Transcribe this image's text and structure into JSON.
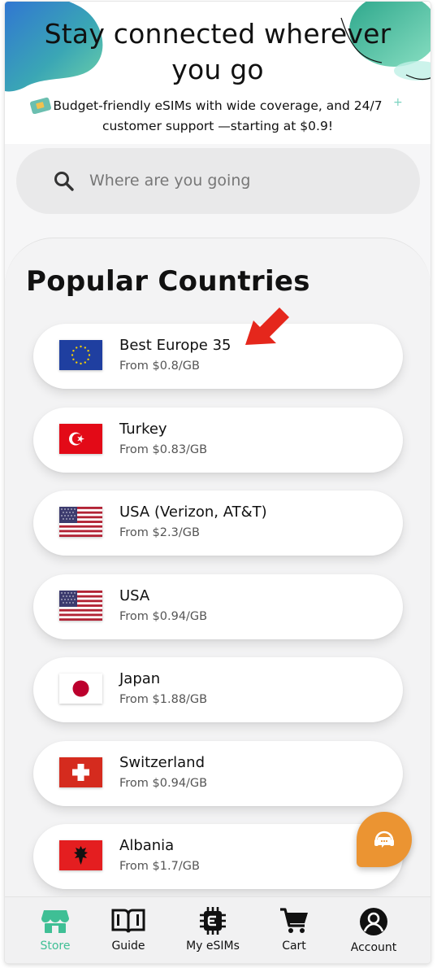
{
  "hero": {
    "title": "Stay connected wherever you go",
    "subtitle": "Budget-friendly eSIMs with wide coverage, and 24/7 customer support —starting at $0.9!"
  },
  "search": {
    "placeholder": "Where are you going"
  },
  "popular": {
    "title": "Popular Countries",
    "items": [
      {
        "name": "Best Europe 35",
        "price": "From $0.8/GB",
        "flag": "eu-flag"
      },
      {
        "name": "Turkey",
        "price": "From $0.83/GB",
        "flag": "turkey-flag"
      },
      {
        "name": "USA (Verizon, AT&T)",
        "price": "From $2.3/GB",
        "flag": "usa-flag"
      },
      {
        "name": "USA",
        "price": "From $0.94/GB",
        "flag": "usa-flag"
      },
      {
        "name": "Japan",
        "price": "From $1.88/GB",
        "flag": "japan-flag"
      },
      {
        "name": "Switzerland",
        "price": "From $0.94/GB",
        "flag": "switzerland-flag"
      },
      {
        "name": "Albania",
        "price": "From $1.7/GB",
        "flag": "albania-flag"
      }
    ]
  },
  "nav": {
    "items": [
      {
        "label": "Store",
        "icon": "store-icon",
        "active": true
      },
      {
        "label": "Guide",
        "icon": "book-icon",
        "active": false
      },
      {
        "label": "My eSIMs",
        "icon": "chip-icon",
        "active": false
      },
      {
        "label": "Cart",
        "icon": "cart-icon",
        "active": false
      },
      {
        "label": "Account",
        "icon": "account-icon",
        "active": false
      }
    ]
  },
  "colors": {
    "accent_green": "#3fbf95",
    "support_orange": "#eb9432",
    "annotation_red": "#e5271c"
  }
}
